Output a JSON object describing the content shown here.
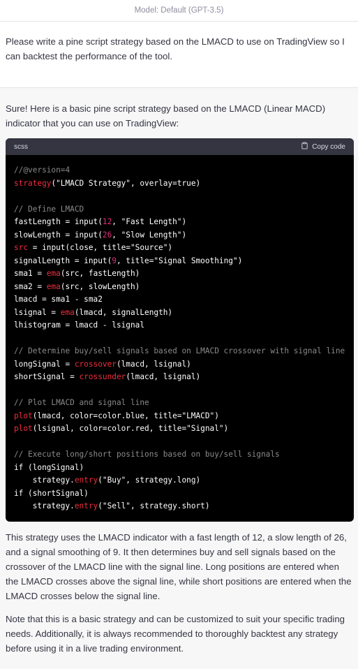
{
  "model_bar": {
    "label": "Model: Default (GPT-3.5)"
  },
  "user_message": {
    "text": "Please write a pine script strategy based on the LMACD to use on TradingView so I can backtest the  performance of the tool."
  },
  "assistant_message": {
    "intro": "Sure! Here is a basic pine script strategy based on the LMACD (Linear MACD) indicator that you can use on TradingView:",
    "code": {
      "language": "scss",
      "copy_label": "Copy code",
      "lines": [
        [
          {
            "t": "//@version=4",
            "c": "comment"
          }
        ],
        [
          {
            "t": "strategy",
            "c": "fn"
          },
          {
            "t": "(",
            "c": "def"
          },
          {
            "t": "\"LMACD Strategy\"",
            "c": "def"
          },
          {
            "t": ", overlay=true)",
            "c": "def"
          }
        ],
        [
          {
            "t": "",
            "c": "def"
          }
        ],
        [
          {
            "t": "// Define LMACD",
            "c": "comment"
          }
        ],
        [
          {
            "t": "fastLength = input(",
            "c": "def"
          },
          {
            "t": "12",
            "c": "num"
          },
          {
            "t": ", \"Fast Length\")",
            "c": "def"
          }
        ],
        [
          {
            "t": "slowLength = input(",
            "c": "def"
          },
          {
            "t": "26",
            "c": "num"
          },
          {
            "t": ", \"Slow Length\")",
            "c": "def"
          }
        ],
        [
          {
            "t": "src",
            "c": "fn"
          },
          {
            "t": " = input(close, title=\"Source\")",
            "c": "def"
          }
        ],
        [
          {
            "t": "signalLength = input(",
            "c": "def"
          },
          {
            "t": "9",
            "c": "num"
          },
          {
            "t": ", title=\"Signal Smoothing\")",
            "c": "def"
          }
        ],
        [
          {
            "t": "sma1 = ",
            "c": "def"
          },
          {
            "t": "ema",
            "c": "fn"
          },
          {
            "t": "(src, fastLength)",
            "c": "def"
          }
        ],
        [
          {
            "t": "sma2 = ",
            "c": "def"
          },
          {
            "t": "ema",
            "c": "fn"
          },
          {
            "t": "(src, slowLength)",
            "c": "def"
          }
        ],
        [
          {
            "t": "lmacd = sma1 - sma2",
            "c": "def"
          }
        ],
        [
          {
            "t": "lsignal = ",
            "c": "def"
          },
          {
            "t": "ema",
            "c": "fn"
          },
          {
            "t": "(lmacd, signalLength)",
            "c": "def"
          }
        ],
        [
          {
            "t": "lhistogram = lmacd - lsignal",
            "c": "def"
          }
        ],
        [
          {
            "t": "",
            "c": "def"
          }
        ],
        [
          {
            "t": "// Determine buy/sell signals based on LMACD crossover with signal line",
            "c": "comment"
          }
        ],
        [
          {
            "t": "longSignal = ",
            "c": "def"
          },
          {
            "t": "crossover",
            "c": "fn"
          },
          {
            "t": "(lmacd, lsignal)",
            "c": "def"
          }
        ],
        [
          {
            "t": "shortSignal = ",
            "c": "def"
          },
          {
            "t": "crossunder",
            "c": "fn"
          },
          {
            "t": "(lmacd, lsignal)",
            "c": "def"
          }
        ],
        [
          {
            "t": "",
            "c": "def"
          }
        ],
        [
          {
            "t": "// Plot LMACD and signal line",
            "c": "comment"
          }
        ],
        [
          {
            "t": "plot",
            "c": "fn"
          },
          {
            "t": "(lmacd, color=color.blue, title=\"LMACD\")",
            "c": "def"
          }
        ],
        [
          {
            "t": "plot",
            "c": "fn"
          },
          {
            "t": "(lsignal, color=color.red, title=\"Signal\")",
            "c": "def"
          }
        ],
        [
          {
            "t": "",
            "c": "def"
          }
        ],
        [
          {
            "t": "// Execute long/short positions based on buy/sell signals",
            "c": "comment"
          }
        ],
        [
          {
            "t": "if (longSignal)",
            "c": "def"
          }
        ],
        [
          {
            "t": "    strategy.",
            "c": "def"
          },
          {
            "t": "entry",
            "c": "fn"
          },
          {
            "t": "(\"Buy\", strategy.long)",
            "c": "def"
          }
        ],
        [
          {
            "t": "if (shortSignal)",
            "c": "def"
          }
        ],
        [
          {
            "t": "    strategy.",
            "c": "def"
          },
          {
            "t": "entry",
            "c": "fn"
          },
          {
            "t": "(\"Sell\", strategy.short)",
            "c": "def"
          }
        ]
      ]
    },
    "para2": "This strategy uses the LMACD indicator with a fast length of 12, a slow length of 26, and a signal smoothing of 9. It then determines buy and sell signals based on the crossover of the LMACD line with the signal line. Long positions are entered when the LMACD crosses above the signal line, while short positions are entered when the LMACD crosses below the signal line.",
    "para3": "Note that this is a basic strategy and can be customized to suit your specific trading needs. Additionally, it is always recommended to thoroughly backtest any strategy before using it in a live trading environment."
  },
  "colors": {
    "code_bg": "#000000",
    "code_header_bg": "#343541",
    "comment": "#8a8a8a",
    "function": "#f22c3d",
    "number": "#df3079"
  },
  "icons": {
    "copy": "clipboard-icon"
  }
}
